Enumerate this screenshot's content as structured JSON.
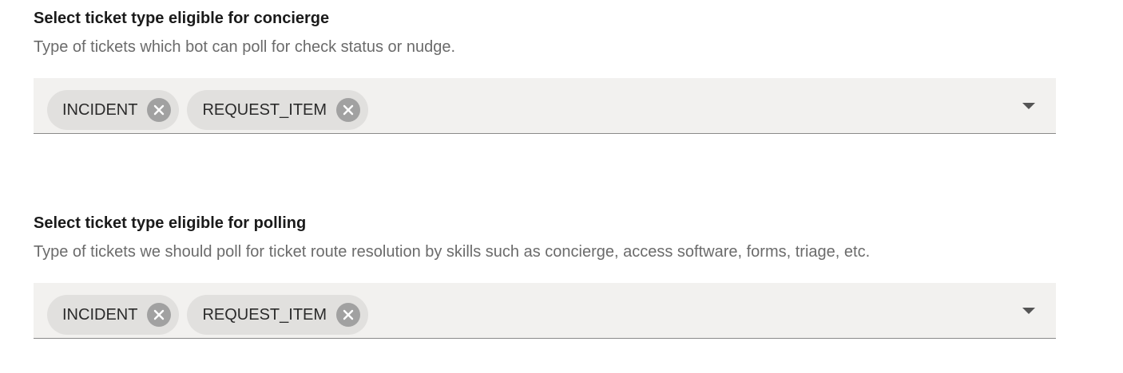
{
  "sections": [
    {
      "title": "Select ticket type eligible for concierge",
      "description": "Type of tickets which bot can poll for check status or nudge.",
      "chips": [
        "INCIDENT",
        "REQUEST_ITEM"
      ],
      "dropdown_icon": "chevron-down-icon"
    },
    {
      "title": "Select ticket type eligible for polling",
      "description": "Type of tickets we should poll for ticket route resolution by skills such as concierge, access software, forms, triage, etc.",
      "chips": [
        "INCIDENT",
        "REQUEST_ITEM"
      ],
      "dropdown_icon": "chevron-down-icon"
    }
  ],
  "colors": {
    "field_background": "#f2f1ef",
    "chip_background": "#e1e0de",
    "chip_remove_background": "#a1a1a1",
    "title_text": "#1a1a1a",
    "description_text": "#6b6b6b"
  }
}
